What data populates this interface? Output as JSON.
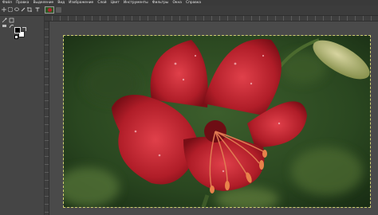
{
  "menubar": {
    "items": [
      "Файл",
      "Правка",
      "Выделение",
      "Вид",
      "Изображение",
      "Слой",
      "Цвет",
      "Инструменты",
      "Фильтры",
      "Окна",
      "Справка"
    ]
  },
  "image_tab": {
    "thumbnail": "lily-thumbnail"
  },
  "toolbox": {
    "tools": [
      "move-tool-icon",
      "rect-select-icon",
      "lasso-icon",
      "fuzzy-select-icon",
      "crop-icon",
      "transform-icon",
      "text-tool-icon",
      "paint-icon"
    ],
    "foreground_color": "#000000",
    "background_color": "#ffffff"
  },
  "canvas": {
    "image_subject": "red lily photo",
    "colors": {
      "flower": "#b11f2a",
      "background": "#2c4a22",
      "canvas_bg": "#4a4a4a"
    }
  }
}
